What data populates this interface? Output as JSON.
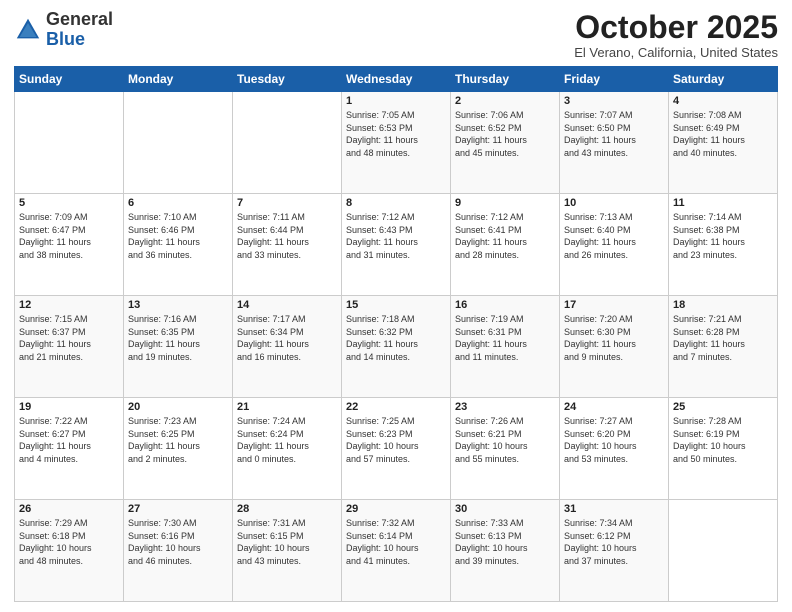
{
  "header": {
    "logo": {
      "general": "General",
      "blue": "Blue"
    },
    "title": "October 2025",
    "subtitle": "El Verano, California, United States"
  },
  "days_of_week": [
    "Sunday",
    "Monday",
    "Tuesday",
    "Wednesday",
    "Thursday",
    "Friday",
    "Saturday"
  ],
  "weeks": [
    [
      {
        "day": "",
        "info": ""
      },
      {
        "day": "",
        "info": ""
      },
      {
        "day": "",
        "info": ""
      },
      {
        "day": "1",
        "info": "Sunrise: 7:05 AM\nSunset: 6:53 PM\nDaylight: 11 hours\nand 48 minutes."
      },
      {
        "day": "2",
        "info": "Sunrise: 7:06 AM\nSunset: 6:52 PM\nDaylight: 11 hours\nand 45 minutes."
      },
      {
        "day": "3",
        "info": "Sunrise: 7:07 AM\nSunset: 6:50 PM\nDaylight: 11 hours\nand 43 minutes."
      },
      {
        "day": "4",
        "info": "Sunrise: 7:08 AM\nSunset: 6:49 PM\nDaylight: 11 hours\nand 40 minutes."
      }
    ],
    [
      {
        "day": "5",
        "info": "Sunrise: 7:09 AM\nSunset: 6:47 PM\nDaylight: 11 hours\nand 38 minutes."
      },
      {
        "day": "6",
        "info": "Sunrise: 7:10 AM\nSunset: 6:46 PM\nDaylight: 11 hours\nand 36 minutes."
      },
      {
        "day": "7",
        "info": "Sunrise: 7:11 AM\nSunset: 6:44 PM\nDaylight: 11 hours\nand 33 minutes."
      },
      {
        "day": "8",
        "info": "Sunrise: 7:12 AM\nSunset: 6:43 PM\nDaylight: 11 hours\nand 31 minutes."
      },
      {
        "day": "9",
        "info": "Sunrise: 7:12 AM\nSunset: 6:41 PM\nDaylight: 11 hours\nand 28 minutes."
      },
      {
        "day": "10",
        "info": "Sunrise: 7:13 AM\nSunset: 6:40 PM\nDaylight: 11 hours\nand 26 minutes."
      },
      {
        "day": "11",
        "info": "Sunrise: 7:14 AM\nSunset: 6:38 PM\nDaylight: 11 hours\nand 23 minutes."
      }
    ],
    [
      {
        "day": "12",
        "info": "Sunrise: 7:15 AM\nSunset: 6:37 PM\nDaylight: 11 hours\nand 21 minutes."
      },
      {
        "day": "13",
        "info": "Sunrise: 7:16 AM\nSunset: 6:35 PM\nDaylight: 11 hours\nand 19 minutes."
      },
      {
        "day": "14",
        "info": "Sunrise: 7:17 AM\nSunset: 6:34 PM\nDaylight: 11 hours\nand 16 minutes."
      },
      {
        "day": "15",
        "info": "Sunrise: 7:18 AM\nSunset: 6:32 PM\nDaylight: 11 hours\nand 14 minutes."
      },
      {
        "day": "16",
        "info": "Sunrise: 7:19 AM\nSunset: 6:31 PM\nDaylight: 11 hours\nand 11 minutes."
      },
      {
        "day": "17",
        "info": "Sunrise: 7:20 AM\nSunset: 6:30 PM\nDaylight: 11 hours\nand 9 minutes."
      },
      {
        "day": "18",
        "info": "Sunrise: 7:21 AM\nSunset: 6:28 PM\nDaylight: 11 hours\nand 7 minutes."
      }
    ],
    [
      {
        "day": "19",
        "info": "Sunrise: 7:22 AM\nSunset: 6:27 PM\nDaylight: 11 hours\nand 4 minutes."
      },
      {
        "day": "20",
        "info": "Sunrise: 7:23 AM\nSunset: 6:25 PM\nDaylight: 11 hours\nand 2 minutes."
      },
      {
        "day": "21",
        "info": "Sunrise: 7:24 AM\nSunset: 6:24 PM\nDaylight: 11 hours\nand 0 minutes."
      },
      {
        "day": "22",
        "info": "Sunrise: 7:25 AM\nSunset: 6:23 PM\nDaylight: 10 hours\nand 57 minutes."
      },
      {
        "day": "23",
        "info": "Sunrise: 7:26 AM\nSunset: 6:21 PM\nDaylight: 10 hours\nand 55 minutes."
      },
      {
        "day": "24",
        "info": "Sunrise: 7:27 AM\nSunset: 6:20 PM\nDaylight: 10 hours\nand 53 minutes."
      },
      {
        "day": "25",
        "info": "Sunrise: 7:28 AM\nSunset: 6:19 PM\nDaylight: 10 hours\nand 50 minutes."
      }
    ],
    [
      {
        "day": "26",
        "info": "Sunrise: 7:29 AM\nSunset: 6:18 PM\nDaylight: 10 hours\nand 48 minutes."
      },
      {
        "day": "27",
        "info": "Sunrise: 7:30 AM\nSunset: 6:16 PM\nDaylight: 10 hours\nand 46 minutes."
      },
      {
        "day": "28",
        "info": "Sunrise: 7:31 AM\nSunset: 6:15 PM\nDaylight: 10 hours\nand 43 minutes."
      },
      {
        "day": "29",
        "info": "Sunrise: 7:32 AM\nSunset: 6:14 PM\nDaylight: 10 hours\nand 41 minutes."
      },
      {
        "day": "30",
        "info": "Sunrise: 7:33 AM\nSunset: 6:13 PM\nDaylight: 10 hours\nand 39 minutes."
      },
      {
        "day": "31",
        "info": "Sunrise: 7:34 AM\nSunset: 6:12 PM\nDaylight: 10 hours\nand 37 minutes."
      },
      {
        "day": "",
        "info": ""
      }
    ]
  ]
}
